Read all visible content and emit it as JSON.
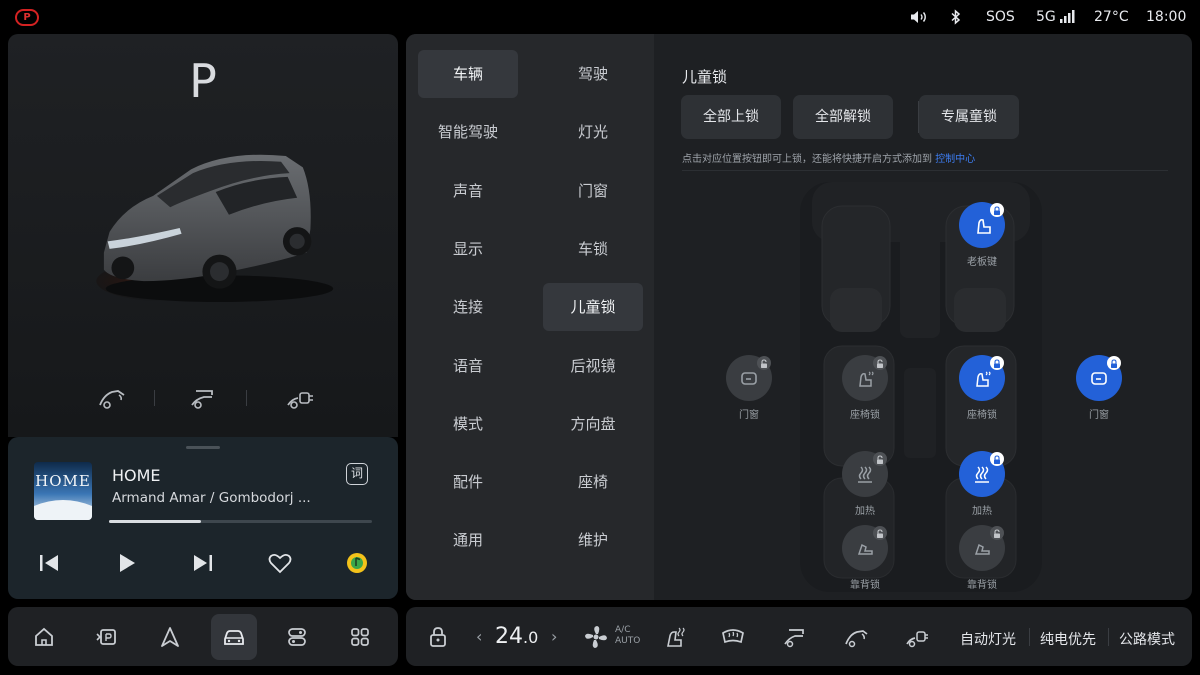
{
  "status_bar": {
    "parking_indicator": "P",
    "sos": "SOS",
    "network": "5G",
    "temperature": "27°C",
    "time": "18:00"
  },
  "vehicle": {
    "gear": "P"
  },
  "media": {
    "album_text": "HOME",
    "title": "HOME",
    "artist": "Armand Amar / Gombodorj ...",
    "lyrics_label": "词",
    "progress": 0.35
  },
  "settings_menu": {
    "left": [
      "车辆",
      "智能驾驶",
      "声音",
      "显示",
      "连接",
      "语音",
      "模式",
      "配件",
      "通用"
    ],
    "right": [
      "驾驶",
      "灯光",
      "门窗",
      "车锁",
      "儿童锁",
      "后视镜",
      "方向盘",
      "座椅",
      "维护"
    ],
    "active_left": "车辆",
    "active_right": "儿童锁"
  },
  "child_lock": {
    "section_title": "儿童锁",
    "buttons": [
      "全部上锁",
      "全部解锁",
      "专属童锁"
    ],
    "hint_text": "点击对应位置按钮即可上锁，还能将快捷开启方式添加到",
    "hint_link": "控制中心",
    "controls": {
      "boss_seat": {
        "label": "老板键",
        "locked": true
      },
      "left_door": {
        "label": "门窗",
        "locked": false
      },
      "right_door": {
        "label": "门窗",
        "locked": true
      },
      "seat_lock_left": {
        "label": "座椅锁",
        "locked": false
      },
      "seat_lock_right": {
        "label": "座椅锁",
        "locked": true
      },
      "heat_left": {
        "label": "加热",
        "locked": false
      },
      "heat_right": {
        "label": "加热",
        "locked": true
      },
      "recline_left": {
        "label": "靠背锁",
        "locked": false
      },
      "recline_right": {
        "label": "靠背锁",
        "locked": false
      }
    }
  },
  "climate_bar": {
    "temp_int": "24",
    "temp_dec": ".0",
    "ac_top": "A/C",
    "ac_bottom": "AUTO",
    "auto_light": "自动灯光",
    "ev_priority": "纯电优先",
    "road_mode": "公路模式"
  },
  "colors": {
    "accent_blue": "#2361d8",
    "link_blue": "#3d7cf0",
    "parking_red": "#d32222",
    "panel_bg": "#1f2124"
  },
  "icons": {
    "dock": [
      "home-icon",
      "parking-icon",
      "navigation-icon",
      "car-icon",
      "controls-icon",
      "apps-icon"
    ],
    "quick": [
      "fuel-door-icon",
      "tailgate-icon",
      "charge-port-icon"
    ]
  }
}
